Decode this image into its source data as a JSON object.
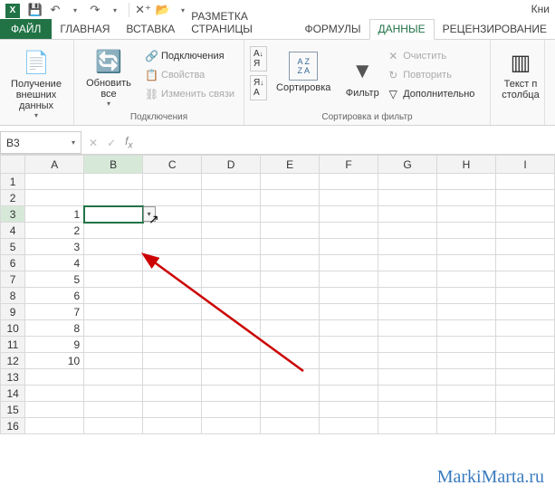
{
  "qat": {
    "save_title": "Сохранить",
    "undo_title": "Отменить",
    "redo_title": "Повторить"
  },
  "book_title": "Кни",
  "tabs": {
    "file": "ФАЙЛ",
    "home": "ГЛАВНАЯ",
    "insert": "ВСТАВКА",
    "layout": "РАЗМЕТКА СТРАНИЦЫ",
    "formulas": "ФОРМУЛЫ",
    "data": "ДАННЫЕ",
    "review": "РЕЦЕНЗИРОВАНИЕ"
  },
  "ribbon": {
    "get_data": "Получение\nвнешних данных",
    "refresh": "Обновить\nвсе",
    "connections": "Подключения",
    "properties": "Свойства",
    "edit_links": "Изменить связи",
    "group_connections": "Подключения",
    "sort_asc": "А↓Я",
    "sort_desc": "Я↓А",
    "sort": "Сортировка",
    "filter": "Фильтр",
    "clear": "Очистить",
    "reapply": "Повторить",
    "advanced": "Дополнительно",
    "group_sort": "Сортировка и фильтр",
    "text_to_col": "Текст п\nстолбца"
  },
  "name_box": "B3",
  "columns": [
    "A",
    "B",
    "C",
    "D",
    "E",
    "F",
    "G",
    "H",
    "I"
  ],
  "rows": [
    1,
    2,
    3,
    4,
    5,
    6,
    7,
    8,
    9,
    10,
    11,
    12,
    13,
    14,
    15,
    16
  ],
  "cells": {
    "A3": "1",
    "A4": "2",
    "A5": "3",
    "A6": "4",
    "A7": "5",
    "A8": "6",
    "A9": "7",
    "A10": "8",
    "A11": "9",
    "A12": "10"
  },
  "selected": {
    "col": "B",
    "row": 3
  },
  "watermark": "MarkiMarta.ru"
}
